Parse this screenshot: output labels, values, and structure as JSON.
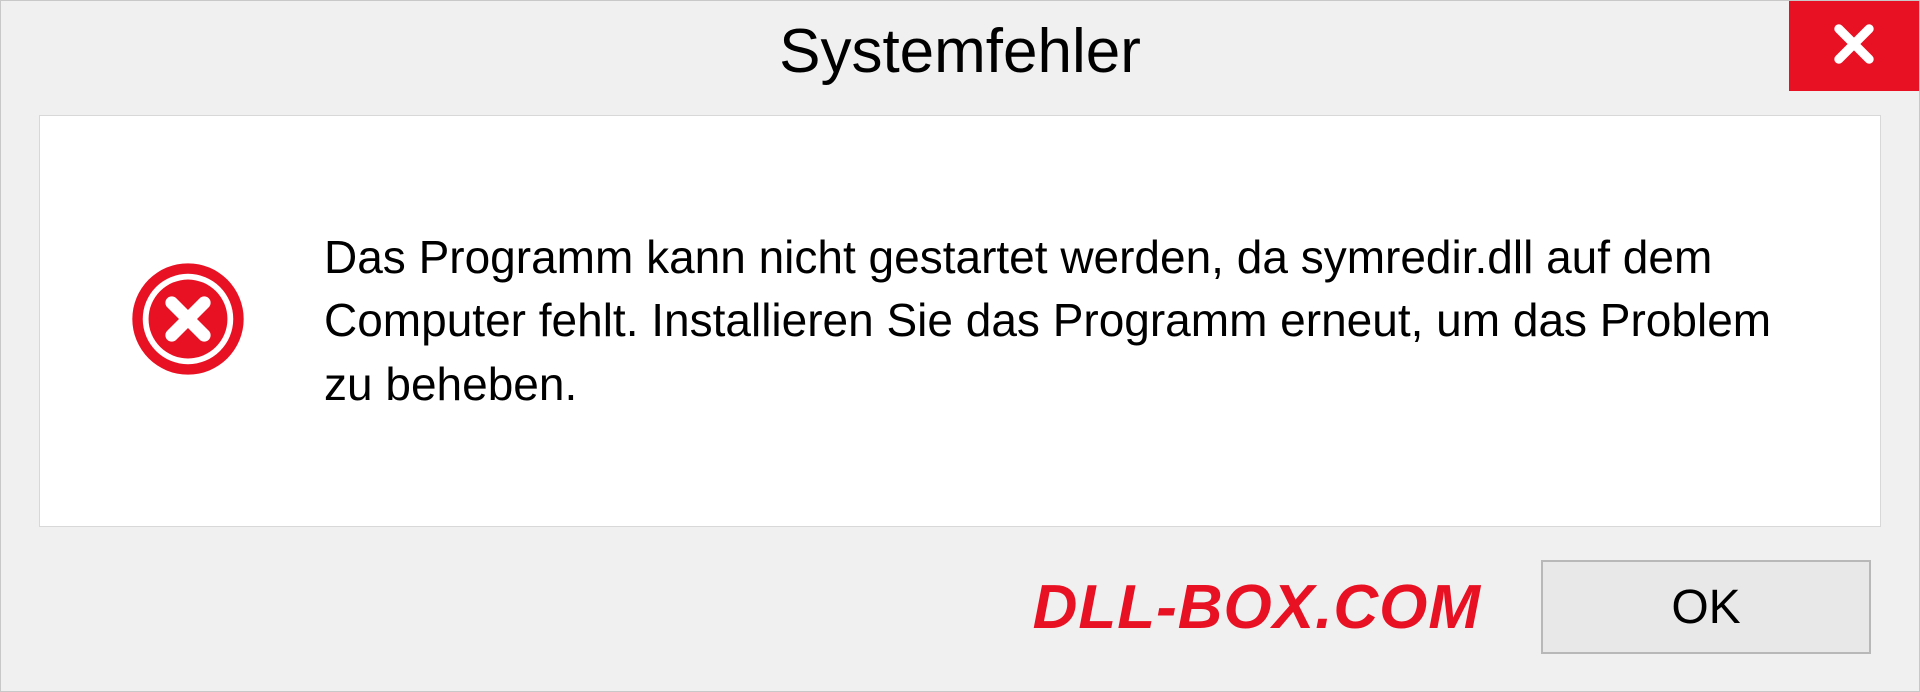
{
  "dialog": {
    "title": "Systemfehler",
    "message": "Das Programm kann nicht gestartet werden, da symredir.dll auf dem Computer fehlt. Installieren Sie das Programm erneut, um das Problem zu beheben.",
    "ok_label": "OK"
  },
  "watermark": "DLL-BOX.COM",
  "colors": {
    "close_bg": "#e81123",
    "error_icon": "#e81123"
  }
}
